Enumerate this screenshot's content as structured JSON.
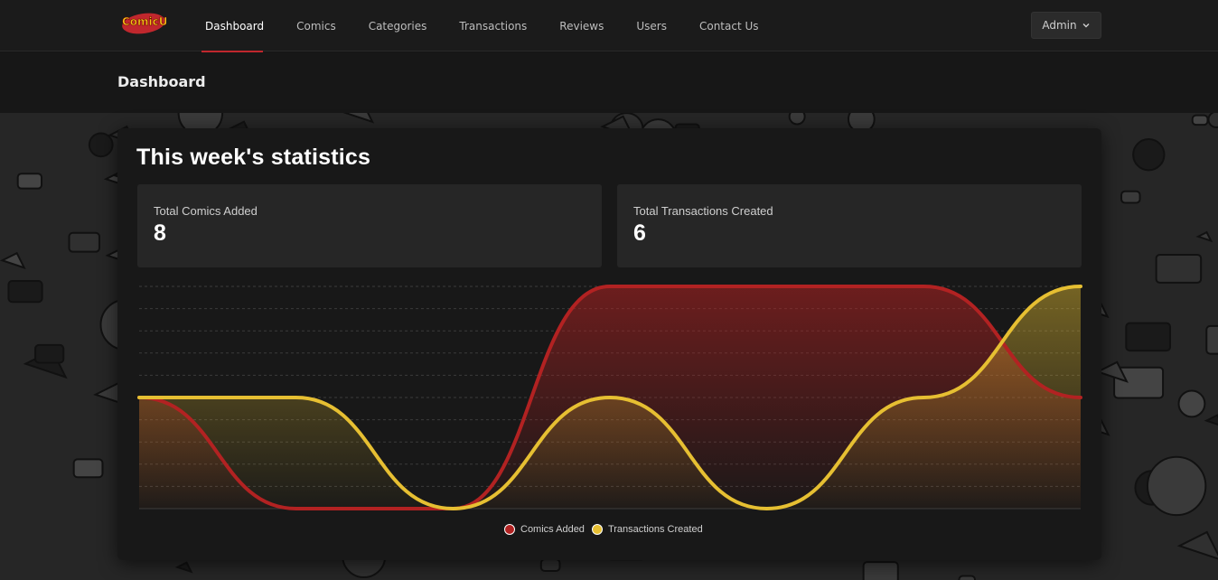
{
  "navbar": {
    "logo_text": "ComicU",
    "items": [
      {
        "label": "Dashboard",
        "active": true
      },
      {
        "label": "Comics",
        "active": false
      },
      {
        "label": "Categories",
        "active": false
      },
      {
        "label": "Transactions",
        "active": false
      },
      {
        "label": "Reviews",
        "active": false
      },
      {
        "label": "Users",
        "active": false
      },
      {
        "label": "Contact Us",
        "active": false
      }
    ],
    "user_menu_label": "Admin"
  },
  "page": {
    "title": "Dashboard"
  },
  "statistics": {
    "title": "This week's statistics",
    "cards": [
      {
        "label": "Total Comics Added",
        "value": "8"
      },
      {
        "label": "Total Transactions Created",
        "value": "6"
      }
    ]
  },
  "colors": {
    "accent_red": "#c0272d",
    "comics_series": "#b22222",
    "transactions_series": "#e6bf32",
    "background": "#141414"
  },
  "chart_data": {
    "type": "area",
    "x": [
      0,
      1,
      2,
      3,
      4,
      5,
      6
    ],
    "ylim": [
      0,
      2
    ],
    "grid": true,
    "legend_position": "bottom",
    "series": [
      {
        "name": "Comics Added",
        "color": "#b22222",
        "values": [
          1,
          0,
          0,
          2,
          2,
          2,
          1
        ]
      },
      {
        "name": "Transactions Created",
        "color": "#e6bf32",
        "values": [
          1,
          1,
          0,
          1,
          0,
          1,
          2
        ]
      }
    ]
  }
}
